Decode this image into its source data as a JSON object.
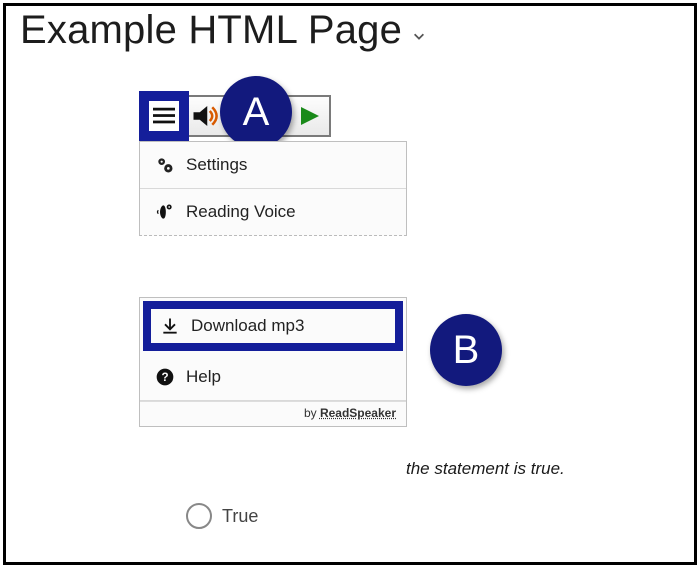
{
  "page": {
    "title": "Example HTML Page"
  },
  "markers": {
    "a": "A",
    "b": "B"
  },
  "menu": {
    "settings": "Settings",
    "reading_voice": "Reading Voice",
    "download_mp3": "Download mp3",
    "help": "Help"
  },
  "attribution": {
    "by": "by ",
    "brand": "ReadSpeaker"
  },
  "background": {
    "fragment": "the statement is true.",
    "option_true": "True"
  },
  "icons": {
    "menu": "menu-icon",
    "speaker": "speaker-icon",
    "play": "play-icon",
    "gear": "gear-icon",
    "voice": "voice-icon",
    "download": "download-icon",
    "help": "help-icon",
    "chevron": "chevron-down-icon"
  }
}
